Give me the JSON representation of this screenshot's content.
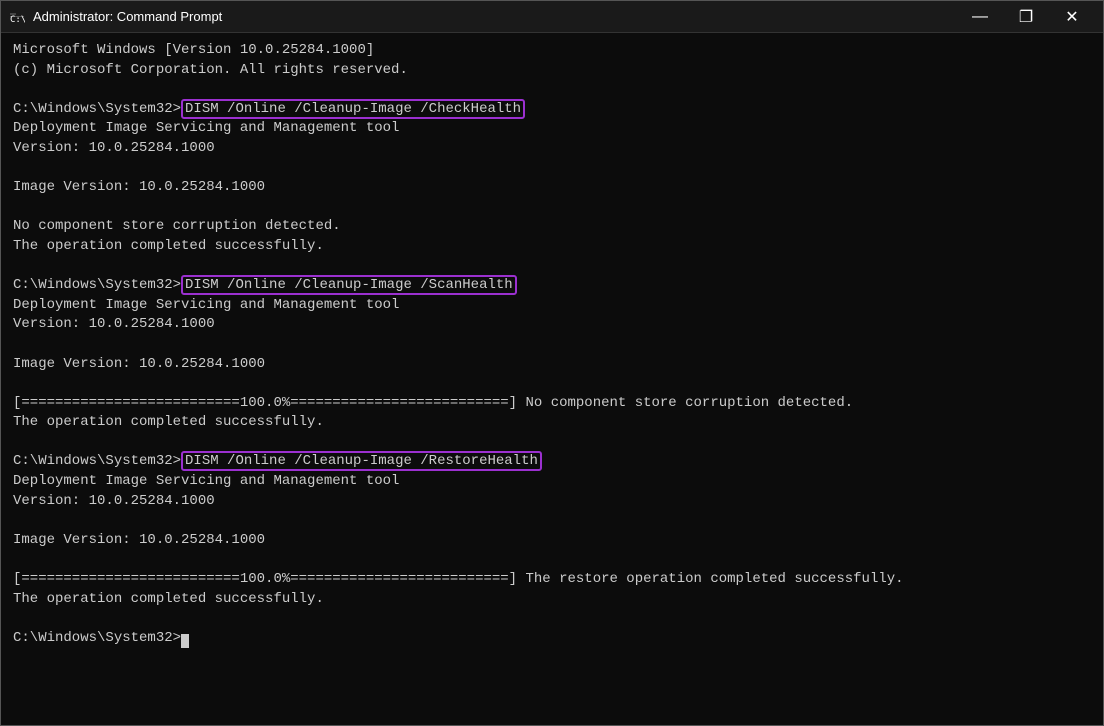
{
  "titleBar": {
    "icon": "cmd-icon",
    "title": "Administrator: Command Prompt",
    "minimizeLabel": "minimize-button",
    "maximizeLabel": "maximize-button",
    "closeLabel": "close-button"
  },
  "terminal": {
    "lines": [
      {
        "type": "normal",
        "text": "Microsoft Windows [Version 10.0.25284.1000]"
      },
      {
        "type": "normal",
        "text": "(c) Microsoft Corporation. All rights reserved."
      },
      {
        "type": "blank",
        "text": ""
      },
      {
        "type": "prompt-cmd",
        "prompt": "C:\\Windows\\System32>",
        "cmd": "DISM /Online /Cleanup-Image /CheckHealth",
        "highlight": true
      },
      {
        "type": "normal",
        "text": "Deployment Image Servicing and Management tool"
      },
      {
        "type": "normal",
        "text": "Version: 10.0.25284.1000"
      },
      {
        "type": "blank",
        "text": ""
      },
      {
        "type": "normal",
        "text": "Image Version: 10.0.25284.1000"
      },
      {
        "type": "blank",
        "text": ""
      },
      {
        "type": "normal",
        "text": "No component store corruption detected."
      },
      {
        "type": "normal",
        "text": "The operation completed successfully."
      },
      {
        "type": "blank",
        "text": ""
      },
      {
        "type": "prompt-cmd",
        "prompt": "C:\\Windows\\System32>",
        "cmd": "DISM /Online /Cleanup-Image /ScanHealth",
        "highlight": true
      },
      {
        "type": "normal",
        "text": "Deployment Image Servicing and Management tool"
      },
      {
        "type": "normal",
        "text": "Version: 10.0.25284.1000"
      },
      {
        "type": "blank",
        "text": ""
      },
      {
        "type": "normal",
        "text": "Image Version: 10.0.25284.1000"
      },
      {
        "type": "blank",
        "text": ""
      },
      {
        "type": "normal",
        "text": "[==========================100.0%==========================] No component store corruption detected."
      },
      {
        "type": "normal",
        "text": "The operation completed successfully."
      },
      {
        "type": "blank",
        "text": ""
      },
      {
        "type": "prompt-cmd",
        "prompt": "C:\\Windows\\System32>",
        "cmd": "DISM /Online /Cleanup-Image /RestoreHealth",
        "highlight": true
      },
      {
        "type": "normal",
        "text": "Deployment Image Servicing and Management tool"
      },
      {
        "type": "normal",
        "text": "Version: 10.0.25284.1000"
      },
      {
        "type": "blank",
        "text": ""
      },
      {
        "type": "normal",
        "text": "Image Version: 10.0.25284.1000"
      },
      {
        "type": "blank",
        "text": ""
      },
      {
        "type": "normal",
        "text": "[==========================100.0%==========================] The restore operation completed successfully."
      },
      {
        "type": "normal",
        "text": "The operation completed successfully."
      },
      {
        "type": "blank",
        "text": ""
      },
      {
        "type": "prompt-cursor",
        "text": "C:\\Windows\\System32>"
      }
    ]
  }
}
